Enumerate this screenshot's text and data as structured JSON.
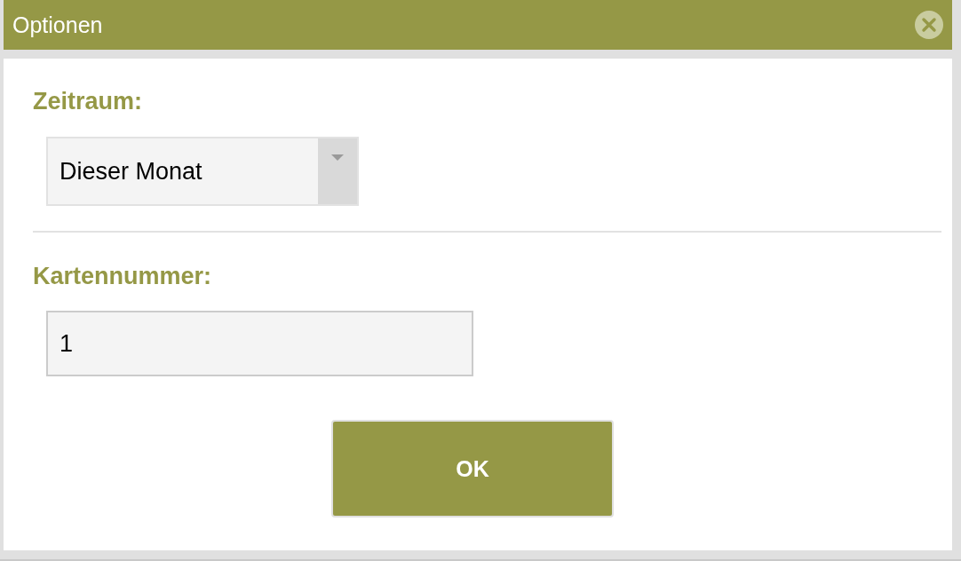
{
  "window": {
    "title": "Optionen"
  },
  "fields": [
    {
      "kind": "select",
      "label": "Zeitraum:",
      "value": "Dieser Monat"
    },
    {
      "kind": "text",
      "label": "Kartennummer:",
      "value": "1"
    }
  ],
  "buttons": [
    "OK"
  ]
}
